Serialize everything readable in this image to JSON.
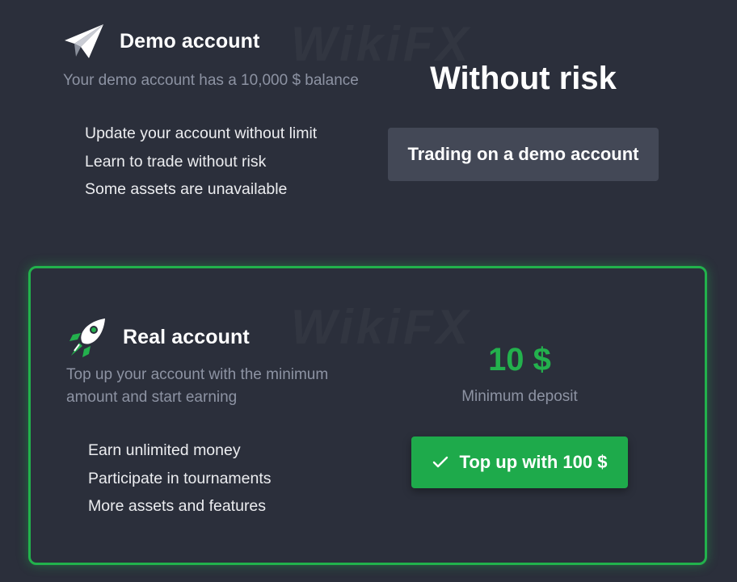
{
  "demo": {
    "title": "Demo account",
    "description": "Your demo account has a 10,000 $ balance",
    "features": [
      "Update your account without limit",
      "Learn to trade without risk",
      "Some assets are unavailable"
    ],
    "heading": "Without risk",
    "button_label": "Trading on a demo account",
    "icon": "paper-plane-icon"
  },
  "real": {
    "title": "Real account",
    "description": "Top up your account with the minimum amount and start earning",
    "features": [
      "Earn unlimited money",
      "Participate in tournaments",
      "More assets and features"
    ],
    "deposit_amount": "10 $",
    "deposit_label": "Minimum deposit",
    "button_label": "Top up with 100 $",
    "icon": "rocket-icon",
    "button_icon": "check-icon"
  },
  "watermark": "WikiFX",
  "colors": {
    "background": "#2b2f3b",
    "accent_green": "#1eaa4b",
    "muted_text": "#8d93a3",
    "demo_button": "#434856"
  }
}
